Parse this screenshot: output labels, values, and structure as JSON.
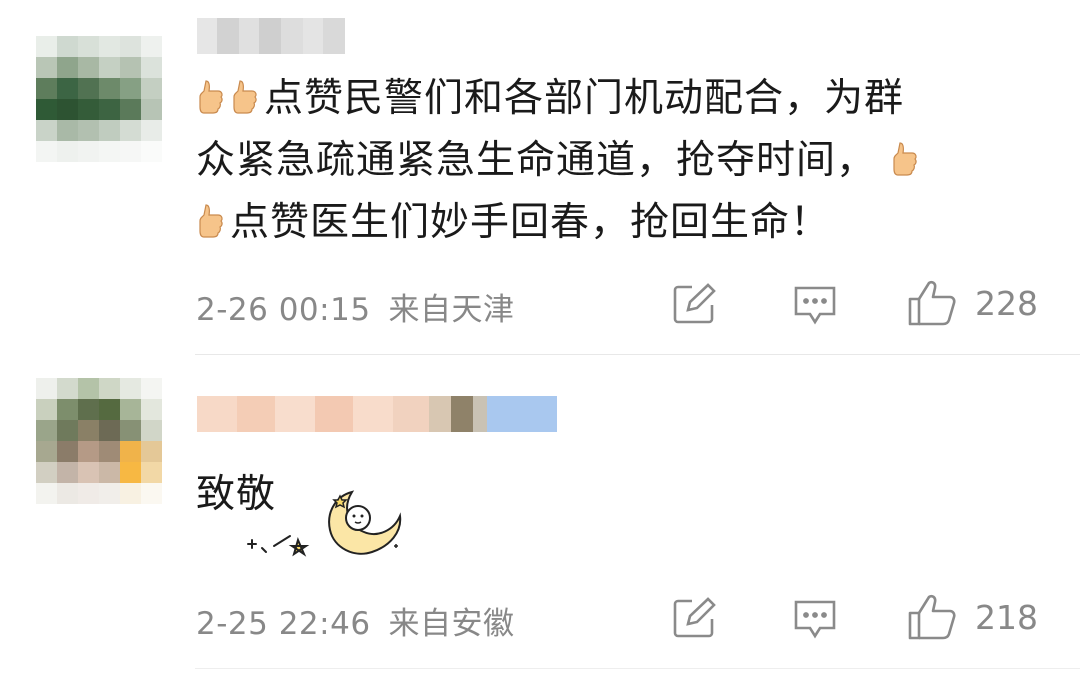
{
  "comments": [
    {
      "text_line1": "点赞民警们和各部门机动配合，为群",
      "text_line2": "众紧急疏通紧急生命通道，抢夺时间，",
      "text_line3": "点赞医生们妙手回春，抢回生命！",
      "date": "2-26 00:15",
      "location": "来自天津",
      "likes": "228",
      "icons": [
        "thumbs-up-emoji",
        "edit-icon",
        "comment-icon",
        "like-icon"
      ]
    },
    {
      "text": "致敬",
      "sticker": "moon-sticker",
      "date": "2-25 22:46",
      "location": "来自安徽",
      "likes": "218",
      "icons": [
        "edit-icon",
        "comment-icon",
        "like-icon"
      ]
    }
  ],
  "colors": {
    "text": "#1a1a1a",
    "meta": "#888888",
    "background": "#ffffff"
  }
}
